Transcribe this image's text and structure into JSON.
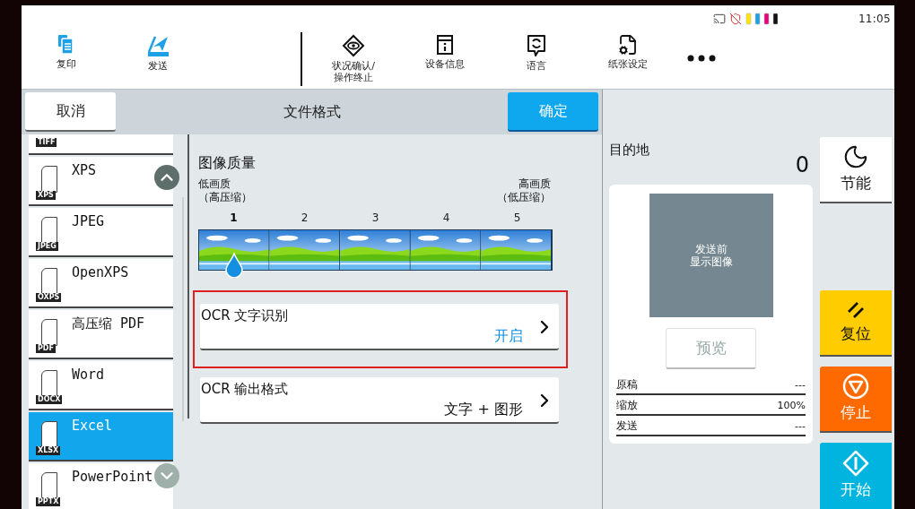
{
  "status": {
    "time": "11:05"
  },
  "toolbar": {
    "apps": [
      {
        "kind": "copy",
        "label": "复印"
      },
      {
        "kind": "send",
        "label": "发送"
      }
    ],
    "tools": [
      {
        "kind": "status",
        "label": "状况确认/",
        "label_2": "操作终止"
      },
      {
        "kind": "device",
        "label": "设备信息"
      },
      {
        "kind": "language",
        "label": "语言"
      },
      {
        "kind": "paper",
        "label": "纸张设定"
      },
      {
        "kind": "more"
      }
    ]
  },
  "header": {
    "cancel": "取消",
    "title": "文件格式",
    "ok": "确定"
  },
  "file_formats": [
    {
      "tag": "TIFF",
      "selected": false
    },
    {
      "name": "XPS",
      "tag": "XPS",
      "selected": false
    },
    {
      "name": "JPEG",
      "tag": "JPEG",
      "selected": false
    },
    {
      "name": "OpenXPS",
      "tag": "OXPS",
      "selected": false
    },
    {
      "name": "高压缩 PDF",
      "tag": "PDF",
      "selected": false
    },
    {
      "name": "Word",
      "tag": "DOCX",
      "selected": false
    },
    {
      "name": "Excel",
      "tag": "XLSX",
      "selected": true
    },
    {
      "name": "PowerPoint",
      "tag": "PPTX",
      "selected": false
    }
  ],
  "scroll": {
    "up_disabled": false,
    "down_disabled": true
  },
  "quality": {
    "title": "图像质量",
    "low_label": "低画质",
    "low_note": "（高压缩）",
    "high_label": "高画质",
    "high_note": "（低压缩）",
    "steps": [
      {
        "label": "1",
        "selected": true
      },
      {
        "label": "2",
        "selected": false
      },
      {
        "label": "3",
        "selected": false
      },
      {
        "label": "4",
        "selected": false
      },
      {
        "label": "5",
        "selected": false
      }
    ]
  },
  "settings": [
    {
      "label": "OCR 文字识别",
      "value": "开启",
      "accent": true,
      "highlighted": true
    },
    {
      "label": "OCR 输出格式",
      "value": "文字 + 图形",
      "accent": false,
      "highlighted": false
    }
  ],
  "destination": {
    "label": "目的地",
    "count": "0",
    "preview_lines": [
      "发送前",
      "显示图像"
    ],
    "preview_button": {
      "label": "预览",
      "disabled": true
    },
    "info": [
      {
        "label": "原稿",
        "value": "---"
      },
      {
        "label": "缩放",
        "value": "100%"
      },
      {
        "label": "发送",
        "value": "---"
      }
    ]
  },
  "side_buttons": [
    {
      "kind": "sleep",
      "label": "节能"
    },
    {
      "kind": "reset",
      "label": "复位"
    },
    {
      "kind": "stop",
      "label": "停止"
    },
    {
      "kind": "start",
      "label": "开始"
    }
  ]
}
